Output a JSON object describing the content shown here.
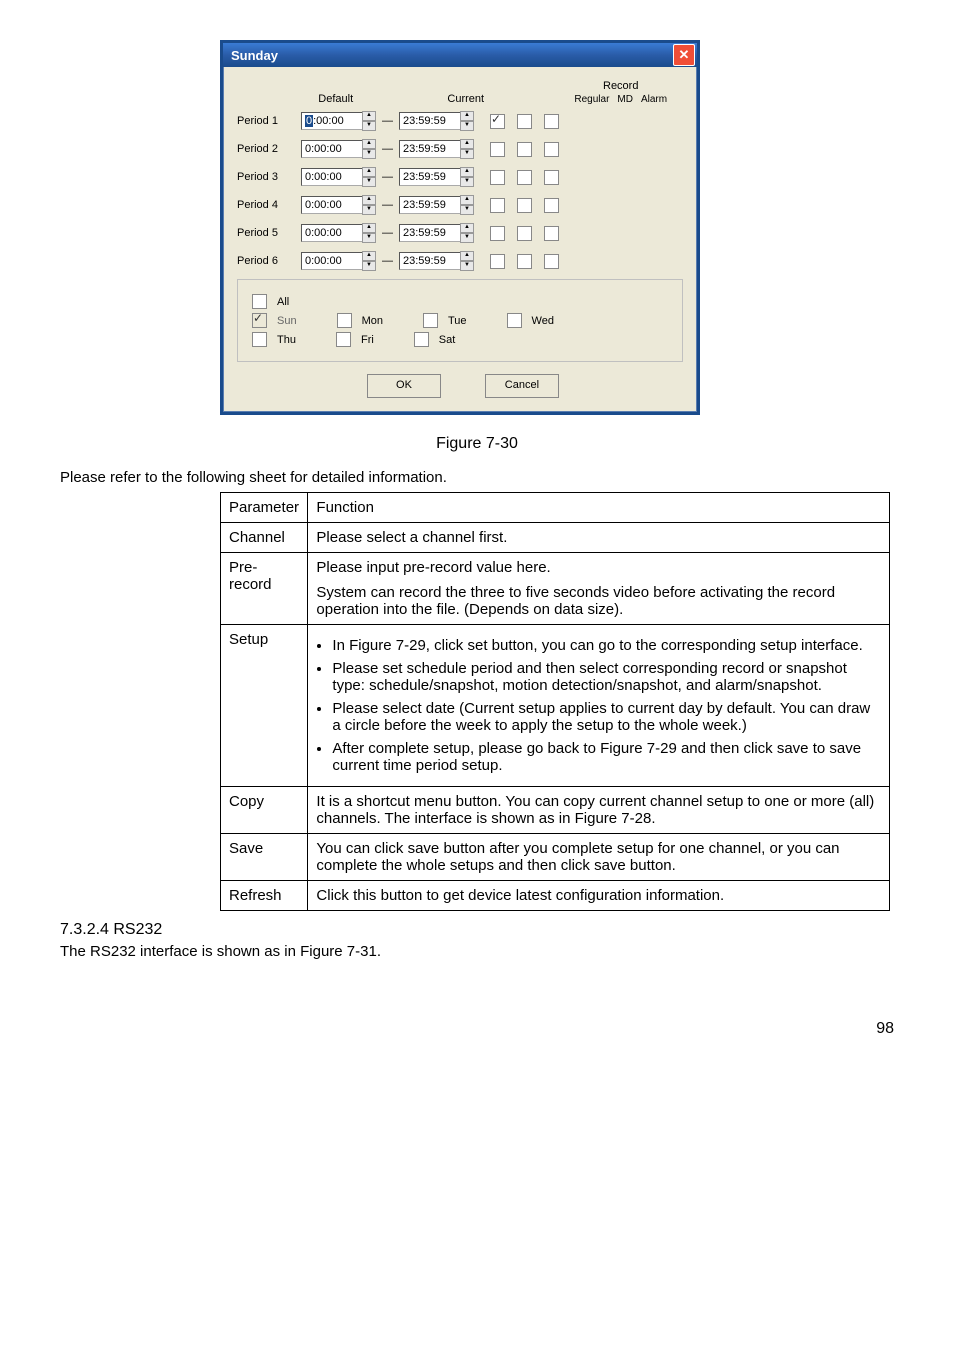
{
  "dialog": {
    "title": "Sunday",
    "headers": {
      "default": "Default",
      "current": "Current",
      "record": "Record",
      "regular": "Regular",
      "md": "MD",
      "alarm": "Alarm"
    },
    "periods": [
      {
        "label": "Period 1",
        "start": "0:00:00",
        "end": "23:59:59",
        "highlight": true,
        "checks": [
          true,
          false,
          false
        ]
      },
      {
        "label": "Period 2",
        "start": "0:00:00",
        "end": "23:59:59",
        "highlight": false,
        "checks": [
          false,
          false,
          false
        ]
      },
      {
        "label": "Period 3",
        "start": "0:00:00",
        "end": "23:59:59",
        "highlight": false,
        "checks": [
          false,
          false,
          false
        ]
      },
      {
        "label": "Period 4",
        "start": "0:00:00",
        "end": "23:59:59",
        "highlight": false,
        "checks": [
          false,
          false,
          false
        ]
      },
      {
        "label": "Period 5",
        "start": "0:00:00",
        "end": "23:59:59",
        "highlight": false,
        "checks": [
          false,
          false,
          false
        ]
      },
      {
        "label": "Period 6",
        "start": "0:00:00",
        "end": "23:59:59",
        "highlight": false,
        "checks": [
          false,
          false,
          false
        ]
      }
    ],
    "days": {
      "all": "All",
      "row1": [
        {
          "label": "Sun",
          "checked": true,
          "disabled": true
        },
        {
          "label": "Mon",
          "checked": false
        },
        {
          "label": "Tue",
          "checked": false
        },
        {
          "label": "Wed",
          "checked": false
        }
      ],
      "row2": [
        {
          "label": "Thu",
          "checked": false
        },
        {
          "label": "Fri",
          "checked": false
        },
        {
          "label": "Sat",
          "checked": false
        }
      ]
    },
    "buttons": {
      "ok": "OK",
      "cancel": "Cancel"
    }
  },
  "caption": "Figure 7-30",
  "intro": "Please refer to the following sheet for detailed information.",
  "table": {
    "headers": {
      "param": "Parameter",
      "func": "Function"
    },
    "rows": [
      {
        "param": "Channel",
        "func": "Please select a channel first."
      },
      {
        "param": "Pre-record",
        "func_line1": "Please input pre-record value here.",
        "func_line2": "System can record the three to five seconds video before activating the record operation into the file. (Depends on data size)."
      },
      {
        "param": "Setup",
        "bullets": [
          "In Figure 7-29, click set button, you can go to the corresponding setup interface.",
          "Please set schedule period and then select corresponding record or snapshot type: schedule/snapshot, motion detection/snapshot, and alarm/snapshot.",
          "Please select date (Current setup applies to current day by default. You can draw a circle before the week to apply the setup to the whole week.)",
          "After complete setup, please go back to Figure 7-29 and then click save to save current time period setup."
        ]
      },
      {
        "param": "Copy",
        "func": "It is a shortcut menu button. You can copy current channel setup to one or more (all) channels.  The interface is shown as in Figure 7-28."
      },
      {
        "param": "Save",
        "func": "You can click save button after you complete setup for one channel, or you can complete the whole setups and then click save button."
      },
      {
        "param": "Refresh",
        "func": "Click this button to get device latest configuration information."
      }
    ]
  },
  "section": {
    "head": "7.3.2.4  RS232",
    "body": "The RS232 interface is shown as in Figure 7-31."
  },
  "page_num": "98"
}
